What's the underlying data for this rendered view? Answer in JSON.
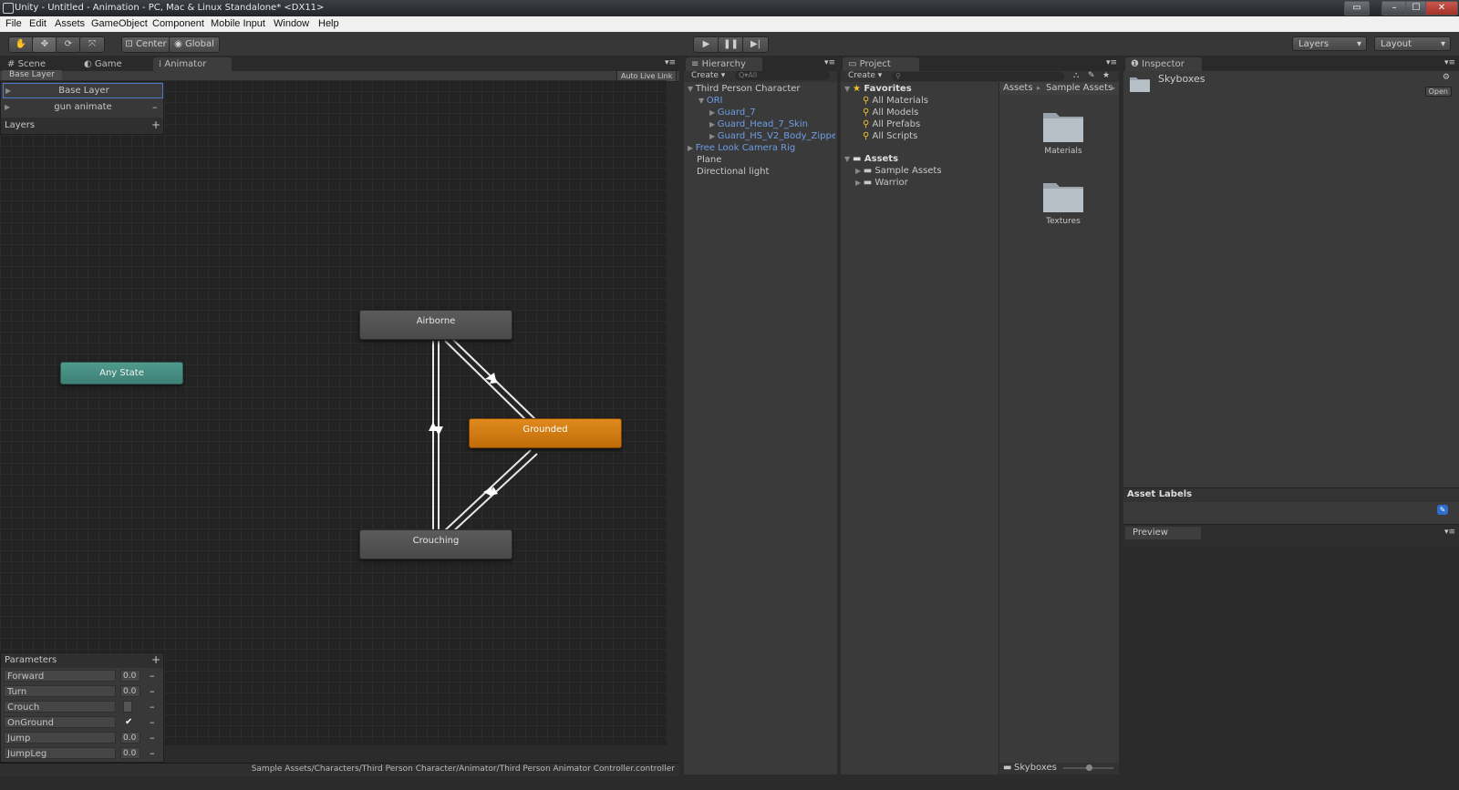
{
  "window": {
    "title": "Unity - Untitled - Animation - PC, Mac & Linux Standalone* <DX11>",
    "controls": [
      "▭",
      "–",
      "☐",
      "✕"
    ]
  },
  "menu": [
    "File",
    "Edit",
    "Assets",
    "GameObject",
    "Component",
    "Mobile Input",
    "Window",
    "Help"
  ],
  "toolbar": {
    "pivot_label": "Center",
    "space_label": "Global",
    "layers_dropdown": "Layers",
    "layout_dropdown": "Layout"
  },
  "animator": {
    "tabs": [
      "Scene",
      "Game",
      "Animator"
    ],
    "breadcrumb": "Base Layer",
    "auto_live_link": "Auto Live Link",
    "layers": [
      {
        "name": "Base Layer"
      },
      {
        "name": "gun animate"
      }
    ],
    "layers_header": "Layers",
    "add_symbol": "+",
    "remove_symbol": "–",
    "states": {
      "airborne": "Airborne",
      "grounded": "Grounded",
      "crouching": "Crouching",
      "any_state": "Any State"
    },
    "parameters_header": "Parameters",
    "parameters": [
      {
        "name": "Forward",
        "value": "0.0"
      },
      {
        "name": "Turn",
        "value": "0.0"
      },
      {
        "name": "Crouch",
        "value": ""
      },
      {
        "name": "OnGround",
        "value": "✔"
      },
      {
        "name": "Jump",
        "value": "0.0"
      },
      {
        "name": "JumpLeg",
        "value": "0.0"
      }
    ],
    "status_path": "Sample Assets/Characters/Third Person Character/Animator/Third Person Animator Controller.controller"
  },
  "hierarchy": {
    "tab": "Hierarchy",
    "create": "Create ▾",
    "search_placeholder": "Q▾All",
    "items": [
      {
        "label": "Third Person Character"
      },
      {
        "label": "ORI"
      },
      {
        "label": "Guard_7"
      },
      {
        "label": "Guard_Head_7_Skin"
      },
      {
        "label": "Guard_HS_V2_Body_Zippe"
      },
      {
        "label": "Free Look Camera Rig"
      },
      {
        "label": "Plane"
      },
      {
        "label": "Directional light"
      }
    ]
  },
  "project": {
    "tab": "Project",
    "create": "Create ▾",
    "favorites_header": "Favorites",
    "favorites": [
      "All Materials",
      "All Models",
      "All Prefabs",
      "All Scripts"
    ],
    "assets_header": "Assets",
    "asset_folders": [
      "Sample Assets",
      "Warrior"
    ],
    "breadcrumb": [
      "Assets",
      "Sample Assets"
    ],
    "grid_items": [
      "Materials",
      "Textures"
    ],
    "footer_selected": "Skyboxes"
  },
  "inspector": {
    "tab": "Inspector",
    "object_name": "Skyboxes",
    "open_button": "Open",
    "asset_labels": "Asset Labels",
    "preview": "Preview"
  },
  "colors": {
    "grounded_state": "#d27a12",
    "any_state": "#4a9083",
    "hierarchy_link": "#6f9de6"
  }
}
